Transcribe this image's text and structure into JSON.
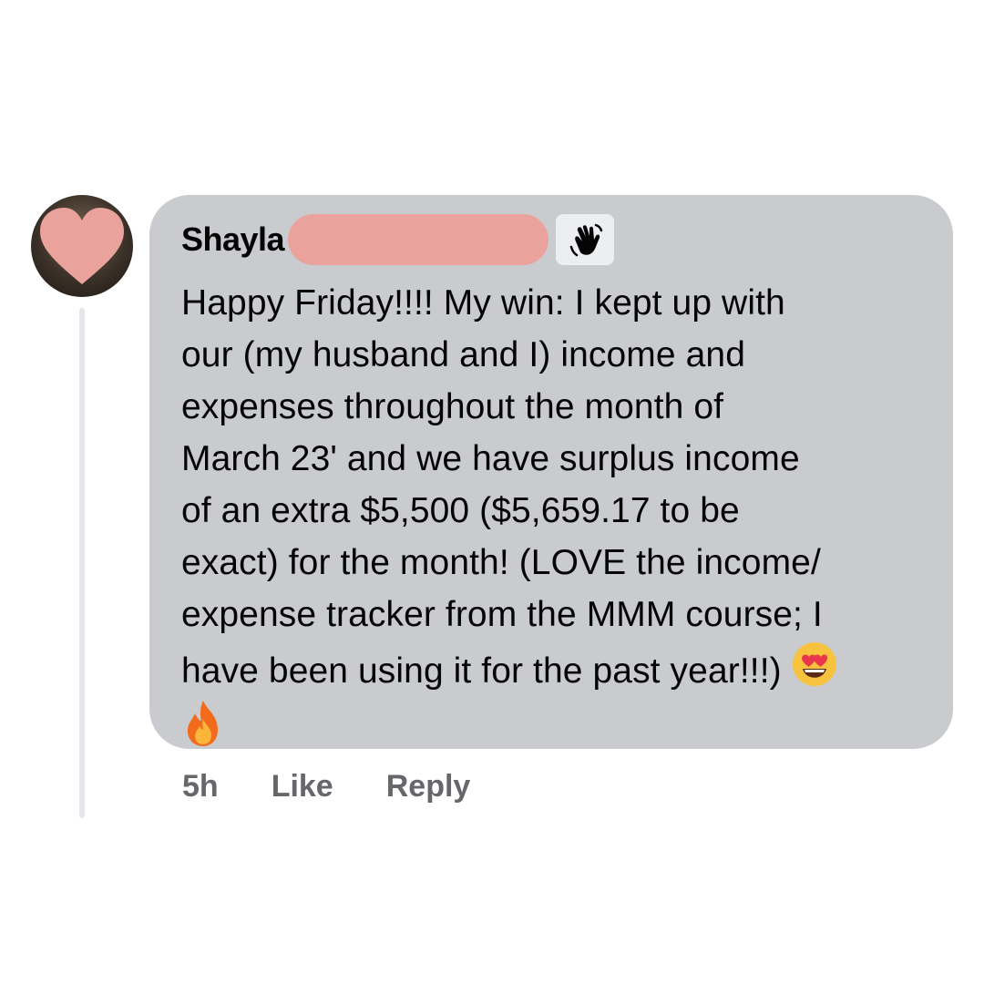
{
  "comment": {
    "author": "Shayla",
    "badge_icon": "waving-hand-icon",
    "text_lines": [
      "Happy Friday!!!! My win: I kept up with",
      "our (my husband and I) income and",
      "expenses throughout the month of",
      "March 23' and we have surplus income",
      "of an extra $5,500 ($5,659.17 to be",
      "exact) for the month! (LOVE the income/",
      "expense tracker from the MMM course; I",
      "have been using it for the past year!!!)"
    ],
    "emojis": [
      "heart-eyes-emoji",
      "fire-emoji"
    ]
  },
  "actions": {
    "time": "5h",
    "like": "Like",
    "reply": "Reply"
  },
  "colors": {
    "bubble": "#c9cbcf",
    "redaction": "#eaa39c",
    "avatar_heart": "#eaa39c",
    "action_text": "#65676b"
  }
}
